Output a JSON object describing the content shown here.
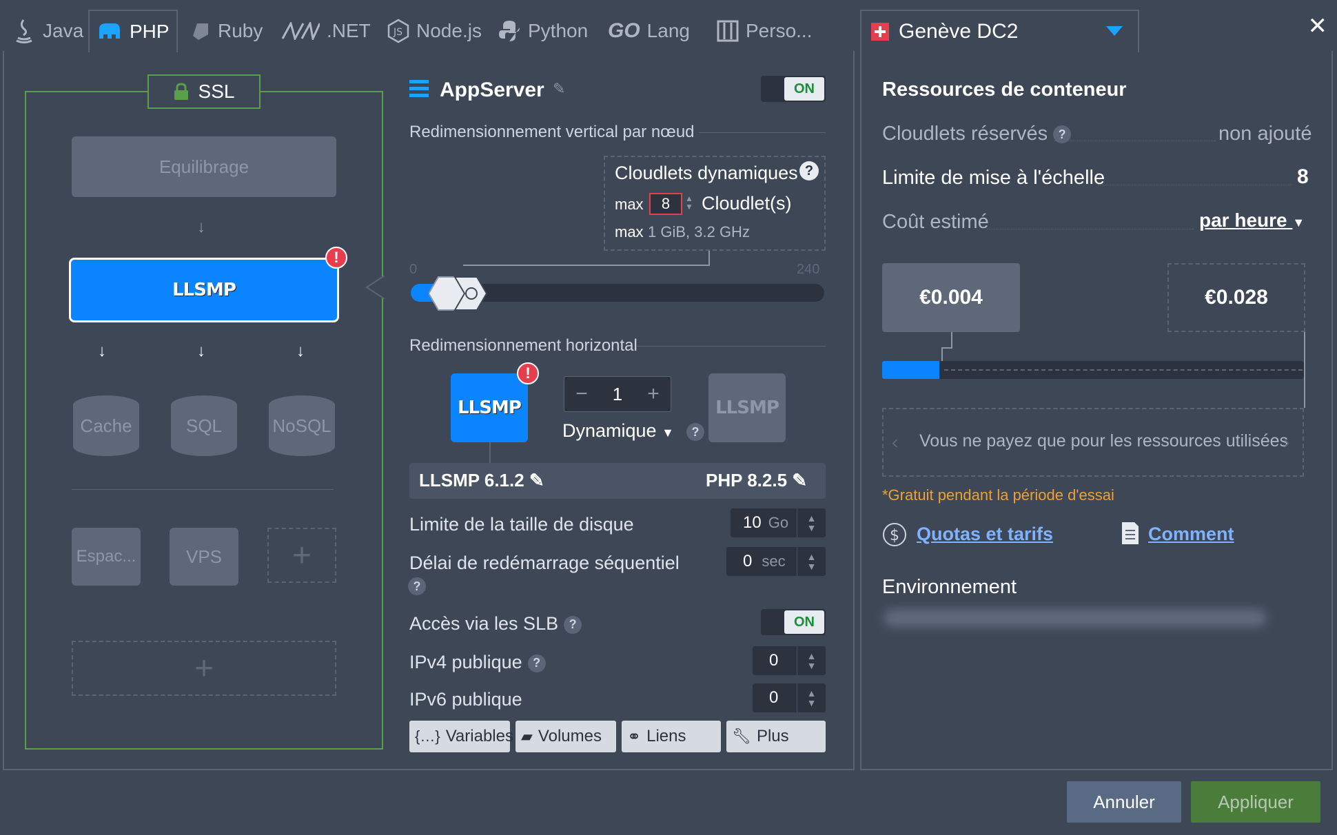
{
  "tabs": [
    {
      "label": "Java",
      "icon": "java-icon"
    },
    {
      "label": "PHP",
      "icon": "php-elephant-icon",
      "active": true
    },
    {
      "label": "Ruby",
      "icon": "ruby-icon"
    },
    {
      "label": ".NET",
      "icon": "dotnet-icon"
    },
    {
      "label": "Node.js",
      "icon": "nodejs-icon"
    },
    {
      "label": "Python",
      "icon": "python-icon"
    },
    {
      "label": "Lang",
      "icon": "go-icon",
      "prefix": "GO"
    },
    {
      "label": "Perso...",
      "icon": "custom-icon"
    }
  ],
  "region": {
    "name": "Genève DC2",
    "flag": "swiss-flag-icon"
  },
  "topology": {
    "ssl": "SSL",
    "balancer": "Equilibrage",
    "app_node": "LLSMP",
    "dbs": [
      "Cache",
      "SQL",
      "NoSQL"
    ],
    "storage": [
      "Espac...",
      "VPS"
    ],
    "add": "+"
  },
  "config": {
    "title": "AppServer",
    "on_label": "ON",
    "vertical_title": "Redimensionnement vertical par nœud",
    "cloudlets_title": "Cloudlets dynamiques",
    "max_label": "max",
    "max_value": "8",
    "cloudlet_unit": "Cloudlet(s)",
    "max_res": "1 GiB, 3.2 GHz",
    "slider_min": "0",
    "slider_max": "240",
    "slider_value": 8,
    "horizontal_title": "Redimensionnement horizontal",
    "node_label": "LLSMP",
    "count": "1",
    "minus": "−",
    "plus": "+",
    "mode": "Dynamique",
    "stack_version": "LLSMP 6.1.2",
    "php_version": "PHP 8.2.5",
    "disk_label": "Limite de la taille de disque",
    "disk_value": "10",
    "disk_unit": "Go",
    "restart_label": "Délai de redémarrage séquentiel",
    "restart_value": "0",
    "restart_unit": "sec",
    "slb_label": "Accès via les SLB",
    "slb_value": "ON",
    "ipv4_label": "IPv4 publique",
    "ipv4_value": "0",
    "ipv6_label": "IPv6 publique",
    "ipv6_value": "0",
    "buttons": [
      "Variables",
      "Volumes",
      "Liens",
      "Plus"
    ]
  },
  "resources": {
    "title": "Ressources de conteneur",
    "reserved_label": "Cloudlets réservés",
    "reserved_value": "non ajouté",
    "limit_label": "Limite de mise à l'échelle",
    "limit_value": "8",
    "cost_label": "Coût estimé",
    "cost_period": "par heure",
    "price_min": "€0.004",
    "price_max": "€0.028",
    "note": "Vous ne payez que pour les ressources utilisées",
    "trial": "*Gratuit pendant la période d'essai",
    "quotas_link": "Quotas et tarifs",
    "how_link": "Comment",
    "env_label": "Environnement"
  },
  "footer": {
    "cancel": "Annuler",
    "apply": "Appliquer"
  },
  "colors": {
    "accent": "#0a84ff",
    "panel": "#3e4756",
    "green": "#5aa04a",
    "trial": "#f0a030",
    "warning": "#e53f4f"
  }
}
